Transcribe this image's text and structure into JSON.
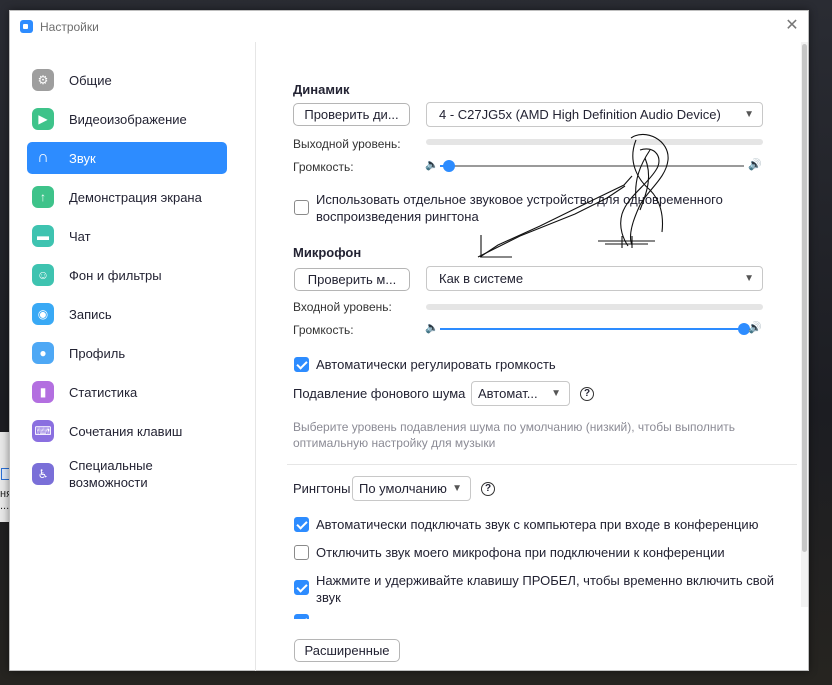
{
  "window": {
    "title": "Настройки"
  },
  "sidebar": {
    "items": [
      {
        "label": "Общие",
        "icon": "gear-icon",
        "color": "#9e9e9e"
      },
      {
        "label": "Видеоизображение",
        "icon": "video-camera-icon",
        "color": "#3ec38a"
      },
      {
        "label": "Звук",
        "icon": "headphones-icon",
        "color": "#2d8cff"
      },
      {
        "label": "Демонстрация экрана",
        "icon": "share-screen-icon",
        "color": "#3ec38a"
      },
      {
        "label": "Чат",
        "icon": "chat-icon",
        "color": "#3ec3b0"
      },
      {
        "label": "Фон и фильтры",
        "icon": "background-icon",
        "color": "#3ec3b0"
      },
      {
        "label": "Запись",
        "icon": "record-icon",
        "color": "#39a9f5"
      },
      {
        "label": "Профиль",
        "icon": "profile-icon",
        "color": "#4ea8f5"
      },
      {
        "label": "Статистика",
        "icon": "statistics-icon",
        "color": "#b36fe0"
      },
      {
        "label": "Сочетания клавиш",
        "icon": "keyboard-icon",
        "color": "#8a6fe0"
      },
      {
        "label": "Специальные\nвозможности",
        "icon": "accessibility-icon",
        "color": "#7a6fd8"
      }
    ],
    "active_index": 2
  },
  "speaker": {
    "heading": "Динамик",
    "test_button": "Проверить ди...",
    "device": "4 - C27JG5x (AMD High Definition Audio Device)",
    "output_level_label": "Выходной уровень:",
    "volume_label": "Громкость:",
    "volume_value": 0.03
  },
  "separate_device": {
    "checked": false,
    "label": "Использовать отдельное звуковое устройство для одновременного воспроизведения рингтона"
  },
  "microphone": {
    "heading": "Микрофон",
    "test_button": "Проверить м...",
    "device": "Как в системе",
    "input_level_label": "Входной уровень:",
    "volume_label": "Громкость:",
    "volume_value": 1.0
  },
  "auto_volume": {
    "checked": true,
    "label": "Автоматически регулировать громкость"
  },
  "noise": {
    "label": "Подавление фонового шума",
    "value": "Автомат...",
    "hint": "Выберите уровень подавления шума по умолчанию (низкий), чтобы выполнить оптимальную настройку для музыки"
  },
  "ringtones": {
    "label": "Рингтоны",
    "value": "По умолчанию"
  },
  "options": [
    {
      "checked": true,
      "label": "Автоматически подключать звук с компьютера при входе в конференцию"
    },
    {
      "checked": false,
      "label": "Отключить звук моего микрофона при подключении к конференции"
    },
    {
      "checked": true,
      "label": "Нажмите и удерживайте клавишу ПРОБЕЛ, чтобы временно включить свой звук"
    }
  ],
  "advanced_button": "Расширенные",
  "desktop": {
    "fragment_text": "няя\n..."
  }
}
